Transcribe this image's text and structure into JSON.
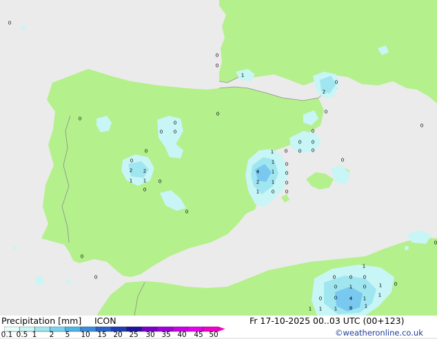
{
  "legend": {
    "title": "Precipitation [mm]",
    "model": "ICON",
    "ticks": [
      "0.1",
      "0.5",
      "1",
      "2",
      "5",
      "10",
      "15",
      "20",
      "25",
      "30",
      "35",
      "40",
      "45",
      "50"
    ],
    "colors": [
      "#e6fffa",
      "#c8f5f5",
      "#a0e6f0",
      "#78d2f0",
      "#50b4e6",
      "#3c8cdc",
      "#2864c8",
      "#1e3cb4",
      "#1e149a",
      "#7800c8",
      "#a000dc",
      "#c800e6",
      "#e600f0",
      "#f000c8"
    ]
  },
  "valid_time": "Fr 17-10-2025 00..03 UTC (00+123)",
  "credit": "©weatheronline.co.uk",
  "map": {
    "land_color": "#b4f08c",
    "sea_color": "#ebebeb",
    "precip_light_color": "#c8f5f5",
    "precip_mid_color": "#a0e6f0",
    "precip_heavy_color": "#78c8f0",
    "values": [
      {
        "id": "atl-nw",
        "text": "0"
      },
      {
        "id": "fr-w1",
        "text": "0"
      },
      {
        "id": "fr-w2",
        "text": "0"
      },
      {
        "id": "fr-sw",
        "text": "1"
      },
      {
        "id": "pyr-e0",
        "text": "0"
      },
      {
        "id": "pyr-e2",
        "text": "2"
      },
      {
        "id": "med-e",
        "text": "0"
      },
      {
        "id": "cat-coast",
        "text": "0"
      },
      {
        "id": "ebro",
        "text": "0"
      },
      {
        "id": "gal",
        "text": "0"
      },
      {
        "id": "cen-1",
        "text": "0"
      },
      {
        "id": "cen-2",
        "text": "0"
      },
      {
        "id": "cen-3",
        "text": "0"
      },
      {
        "id": "cen-4",
        "text": "0"
      },
      {
        "id": "mad-0",
        "text": "0"
      },
      {
        "id": "mad-2a",
        "text": "2"
      },
      {
        "id": "mad-2b",
        "text": "2"
      },
      {
        "id": "mad-1a",
        "text": "1"
      },
      {
        "id": "mad-1b",
        "text": "1"
      },
      {
        "id": "mad-0b",
        "text": "0"
      },
      {
        "id": "mad-0c",
        "text": "0"
      },
      {
        "id": "cat-0a",
        "text": "0"
      },
      {
        "id": "cat-0b",
        "text": "0"
      },
      {
        "id": "cat-0c",
        "text": "0"
      },
      {
        "id": "cat-0d",
        "text": "0"
      },
      {
        "id": "cat-0e",
        "text": "0"
      },
      {
        "id": "val-1a",
        "text": "1"
      },
      {
        "id": "val-0a",
        "text": "0"
      },
      {
        "id": "val-0b",
        "text": "0"
      },
      {
        "id": "val-4",
        "text": "4"
      },
      {
        "id": "val-1b",
        "text": "1"
      },
      {
        "id": "val-0c",
        "text": "0"
      },
      {
        "id": "val-2",
        "text": "2"
      },
      {
        "id": "val-1c",
        "text": "1"
      },
      {
        "id": "val-0d",
        "text": "0"
      },
      {
        "id": "val-1d",
        "text": "1"
      },
      {
        "id": "val-1e",
        "text": "1"
      },
      {
        "id": "val-0e",
        "text": "0"
      },
      {
        "id": "bal-0",
        "text": "0"
      },
      {
        "id": "bal-0b",
        "text": "0"
      },
      {
        "id": "mur-0",
        "text": "0"
      },
      {
        "id": "and-0",
        "text": "0"
      },
      {
        "id": "mor-0",
        "text": "0"
      },
      {
        "id": "alg-1",
        "text": "1"
      },
      {
        "id": "alg-0a",
        "text": "0"
      },
      {
        "id": "alg-0b",
        "text": "0"
      },
      {
        "id": "alg-0c",
        "text": "0"
      },
      {
        "id": "alg-0d",
        "text": "0"
      },
      {
        "id": "alg-0e",
        "text": "0"
      },
      {
        "id": "alg-1b",
        "text": "1"
      },
      {
        "id": "alg-0f",
        "text": "0"
      },
      {
        "id": "alg-1c",
        "text": "1"
      },
      {
        "id": "alg-0g",
        "text": "0"
      },
      {
        "id": "alg-0h",
        "text": "0"
      },
      {
        "id": "alg-1d",
        "text": "1"
      },
      {
        "id": "alg-4",
        "text": "4"
      },
      {
        "id": "alg-1e",
        "text": "1"
      },
      {
        "id": "alg-1f",
        "text": "1"
      },
      {
        "id": "alg-1g",
        "text": "1"
      },
      {
        "id": "alg-8",
        "text": "8"
      },
      {
        "id": "alg-1h",
        "text": "1"
      },
      {
        "id": "alg-0i",
        "text": "0"
      },
      {
        "id": "alg-1i",
        "text": "1"
      }
    ]
  }
}
